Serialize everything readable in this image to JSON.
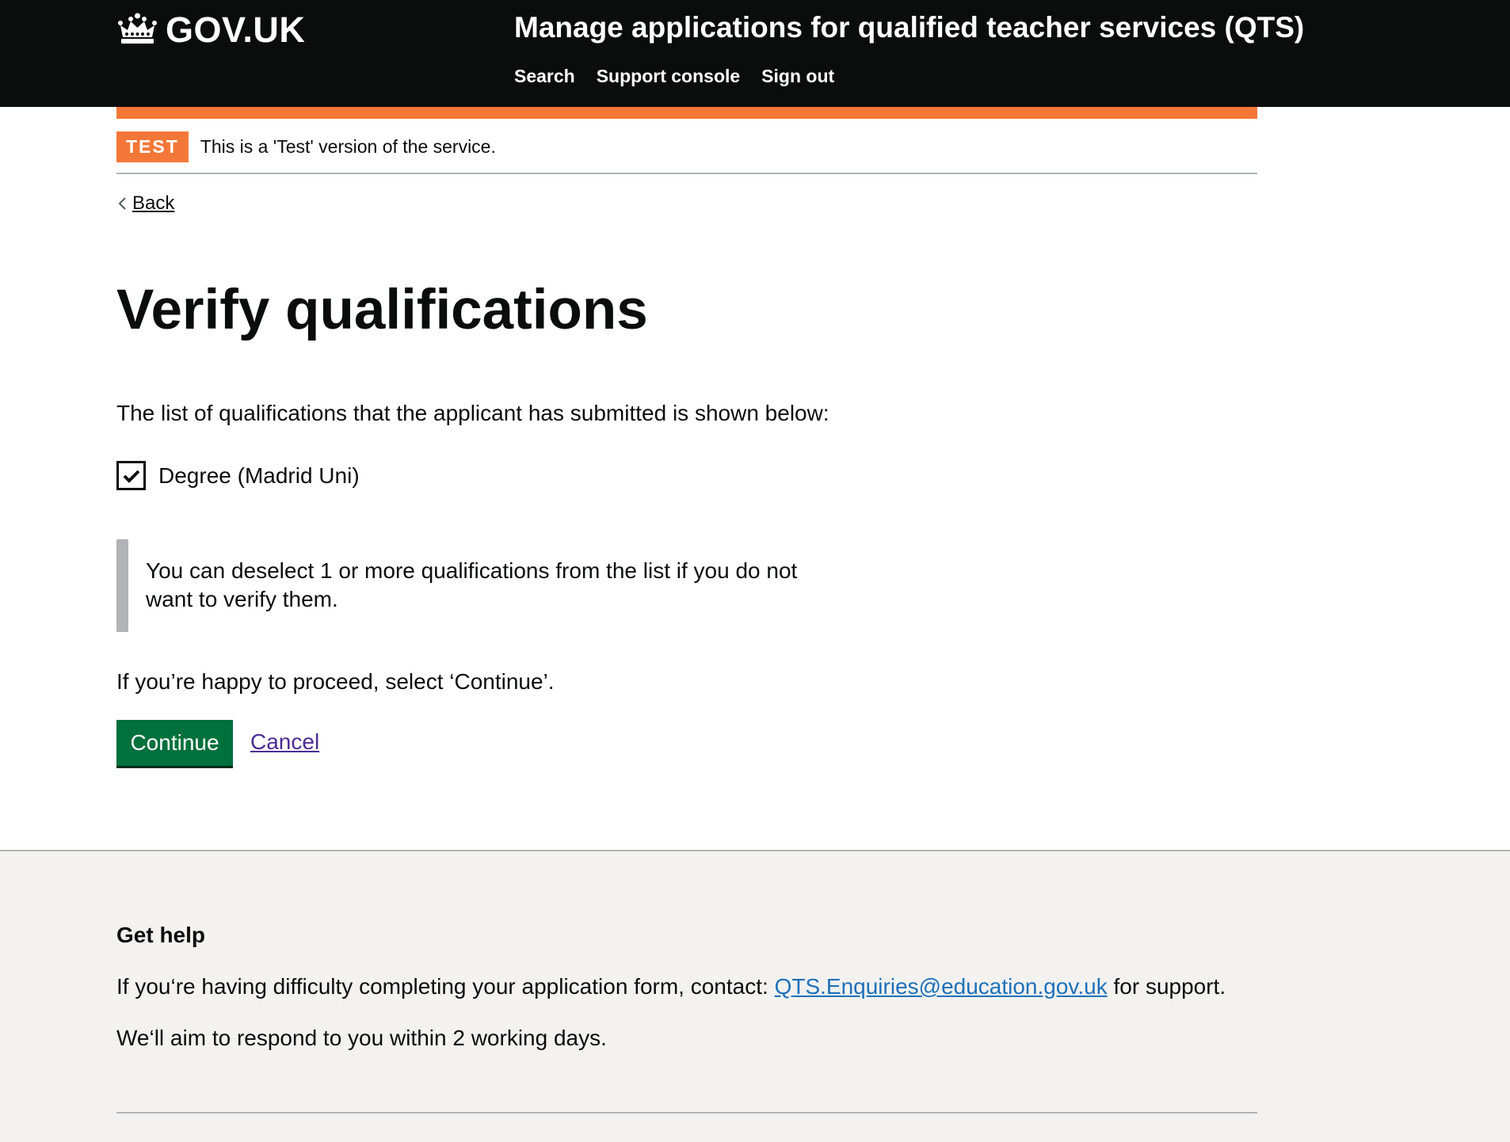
{
  "header": {
    "logo_text": "GOV.UK",
    "service_name": "Manage applications for qualified teacher services (QTS)",
    "nav": [
      {
        "label": "Search"
      },
      {
        "label": "Support console"
      },
      {
        "label": "Sign out"
      }
    ]
  },
  "phase_banner": {
    "tag": "TEST",
    "text": "This is a 'Test' version of the service."
  },
  "back_link": "Back",
  "main": {
    "title": "Verify qualifications",
    "lead": "The list of qualifications that the applicant has submitted is shown below:",
    "qualifications": [
      {
        "label": "Degree (Madrid Uni)",
        "checked": true
      }
    ],
    "inset_text": "You can deselect 1 or more qualifications from the list if you do not want to verify them.",
    "proceed_text": "If you’re happy to proceed, select ‘Continue’.",
    "continue_label": "Continue",
    "cancel_label": "Cancel"
  },
  "footer": {
    "help_title": "Get help",
    "help_text_before": "If you‘re having difficulty completing your application form, contact: ",
    "help_email": "QTS.Enquiries@education.gov.uk",
    "help_text_after": " for support.",
    "respond_text": "We‘ll aim to respond to you within 2 working days."
  },
  "colors": {
    "header_bg": "#0b0c0c",
    "phase_orange": "#f47738",
    "button_green": "#00703c",
    "link_visited": "#4c2c92",
    "link_blue": "#1d70b8",
    "footer_bg": "#f3f2f1"
  },
  "icons": [
    "crown-icon",
    "chevron-left-icon",
    "checkmark-icon"
  ]
}
